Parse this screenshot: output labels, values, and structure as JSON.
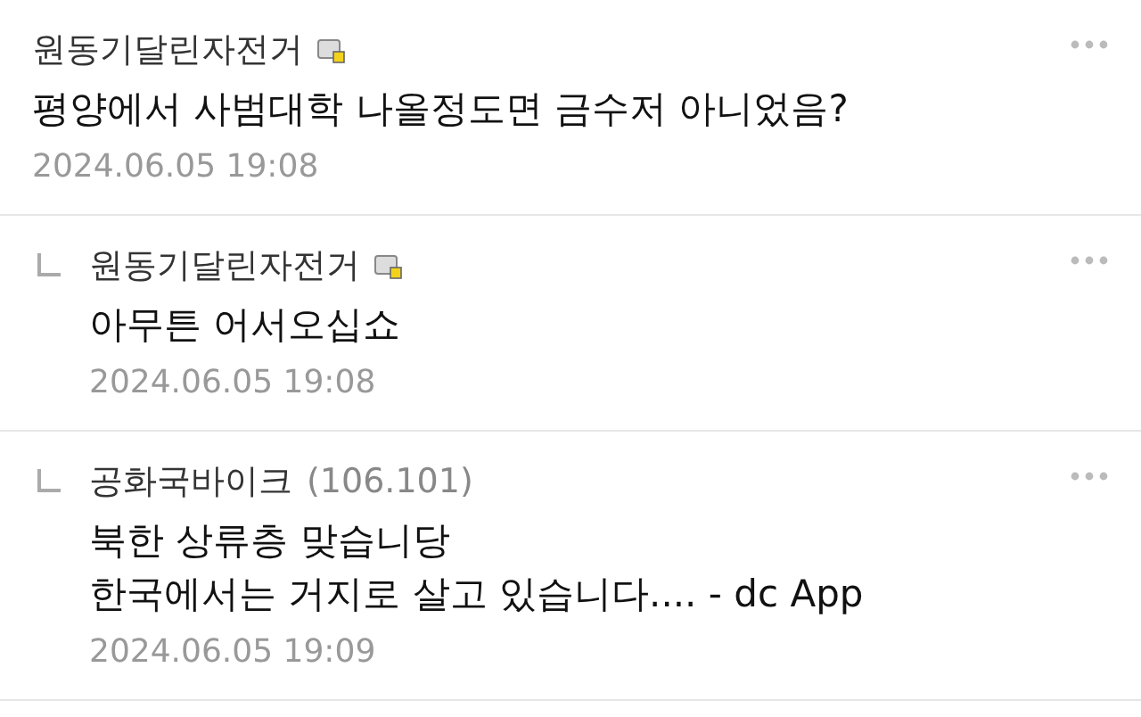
{
  "comments": [
    {
      "kind": "comment",
      "author": "원동기달린자전거",
      "fixed_nick": true,
      "lines": [
        "평양에서 사범대학 나올정도면 금수저 아니었음?"
      ],
      "date": "2024.06.05 19:08"
    },
    {
      "kind": "reply",
      "author": "원동기달린자전거",
      "fixed_nick": true,
      "lines": [
        "아무튼 어서오십쇼"
      ],
      "date": "2024.06.05 19:08"
    },
    {
      "kind": "reply",
      "author": "공화국바이크",
      "ip": "(106.101)",
      "fixed_nick": false,
      "lines": [
        "북한 상류층 맞습니당",
        "한국에서는 거지로 살고 있습니다.... - dc App"
      ],
      "date": "2024.06.05 19:09"
    }
  ]
}
